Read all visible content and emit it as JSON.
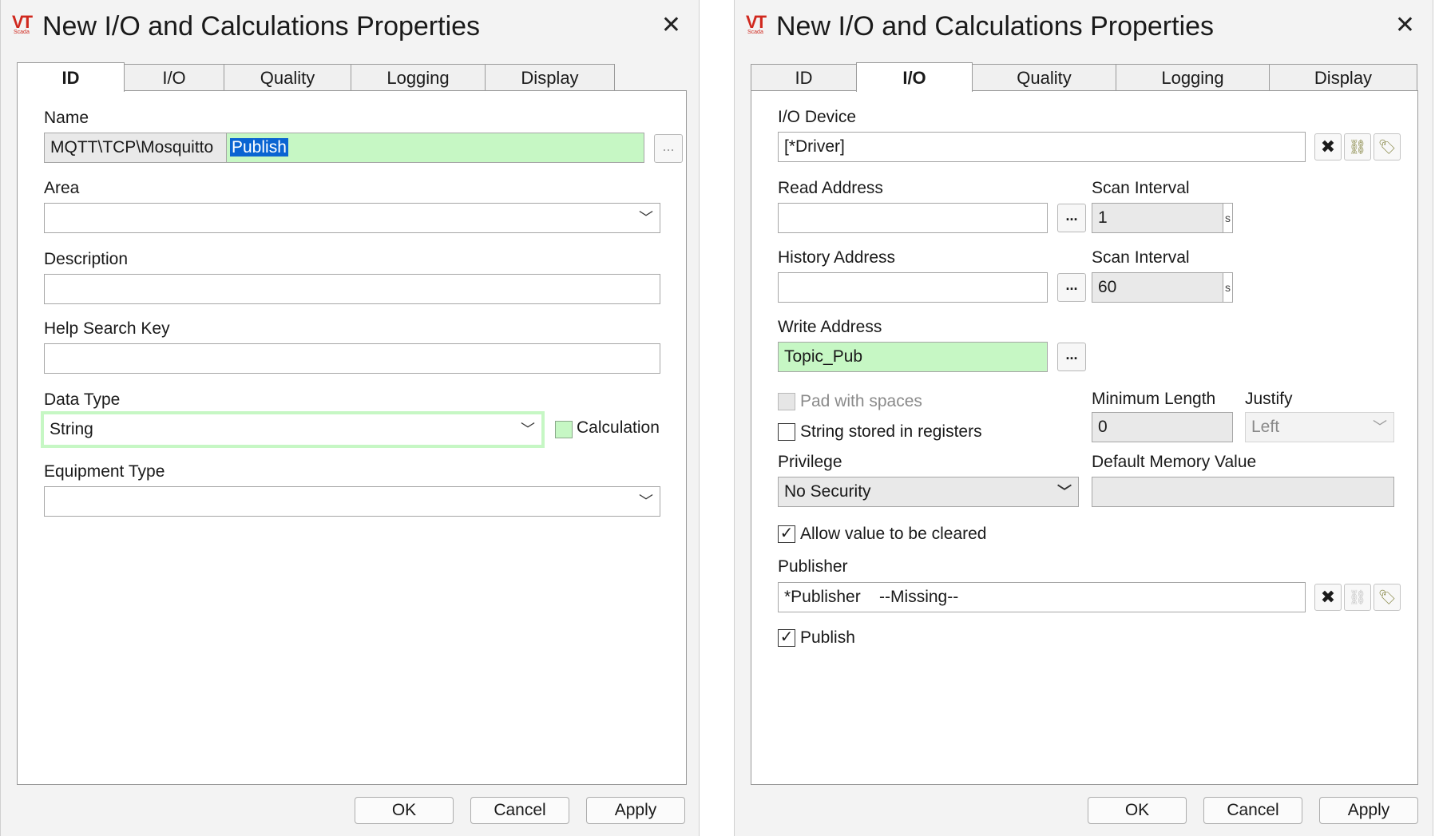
{
  "dialogs": [
    {
      "title": "New I/O and Calculations Properties",
      "tabs": [
        "ID",
        "I/O",
        "Quality",
        "Logging",
        "Display"
      ],
      "active_tab": "ID",
      "name_label": "Name",
      "name_prefix": "MQTT\\TCP\\Mosquitto",
      "name_value": "Publish",
      "area_label": "Area",
      "area_value": "",
      "description_label": "Description",
      "description_value": "",
      "help_label": "Help Search Key",
      "help_value": "",
      "datatype_label": "Data Type",
      "datatype_value": "String",
      "calculation_label": "Calculation",
      "equipment_label": "Equipment Type",
      "equipment_value": "",
      "buttons": {
        "ok": "OK",
        "cancel": "Cancel",
        "apply": "Apply"
      }
    },
    {
      "title": "New I/O and Calculations Properties",
      "tabs": [
        "ID",
        "I/O",
        "Quality",
        "Logging",
        "Display"
      ],
      "active_tab": "I/O",
      "io_device_label": "I/O Device",
      "io_device_value": "[*Driver]",
      "read_address_label": "Read Address",
      "read_address_value": "",
      "scan_interval_label": "Scan Interval",
      "scan_interval_value": "1",
      "history_address_label": "History Address",
      "history_address_value": "",
      "history_scan_label": "Scan Interval",
      "history_scan_value": "60",
      "unit": "s",
      "write_address_label": "Write Address",
      "write_address_value": "Topic_Pub",
      "pad_spaces_label": "Pad with spaces",
      "pad_spaces_checked": false,
      "string_registers_label": "String stored in registers",
      "string_registers_checked": false,
      "min_length_label": "Minimum Length",
      "min_length_value": "0",
      "justify_label": "Justify",
      "justify_value": "Left",
      "privilege_label": "Privilege",
      "privilege_value": "No Security",
      "default_mem_label": "Default Memory Value",
      "default_mem_value": "",
      "allow_clear_label": "Allow value to be cleared",
      "allow_clear_checked": true,
      "publisher_label": "Publisher",
      "publisher_value": "*Publisher    --Missing--",
      "publish_label": "Publish",
      "publish_checked": true,
      "buttons": {
        "ok": "OK",
        "cancel": "Cancel",
        "apply": "Apply"
      }
    }
  ],
  "ellipsis": "...",
  "checkmark": "✓"
}
